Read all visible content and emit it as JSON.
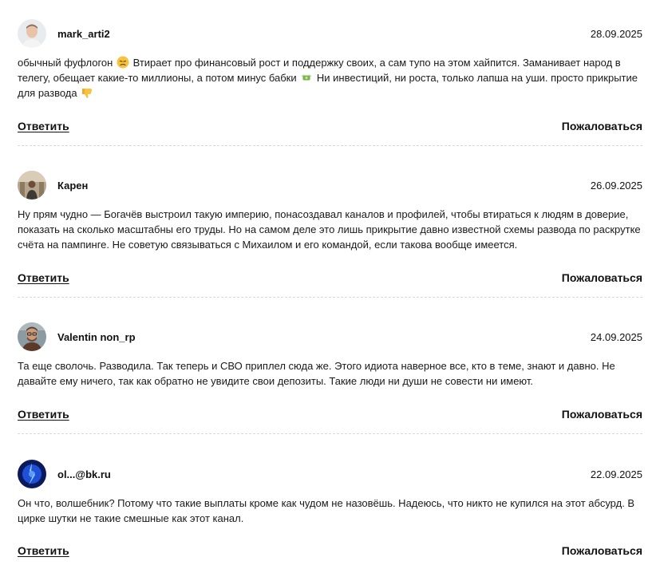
{
  "comments": [
    {
      "author": "mark_arti2",
      "date": "28.09.2025",
      "text_parts": [
        "обычный фуфлогон",
        "Втирает про финансовый рост и поддержку своих, а сам тупо на этом хайпится. Заманивает народ в телегу, обещает какие-то миллионы, а потом минус бабки",
        "Ни инвестиций, ни роста, только лапша на уши. просто прикрытие для развода"
      ],
      "emojis": [
        "disappointed-face-icon",
        "money-with-wings-icon",
        "thumbs-down-icon"
      ]
    },
    {
      "author": "Карен",
      "date": "26.09.2025",
      "text": "Ну прям чудно — Богачёв выстроил такую империю, понасоздавал каналов и профилей, чтобы втираться к людям в доверие, показать на сколько масштабны его труды. Но на самом деле это лишь прикрытие давно известной схемы развода по раскрутке счёта на пампинге. Не советую связываться с Михаилом и его командой, если такова вообще имеется."
    },
    {
      "author": "Valentin non_rp",
      "date": "24.09.2025",
      "text": "Та еще сволочь. Разводила. Так теперь и СВО приплел сюда же. Этого идиота наверное все, кто в теме, знают и давно. Не давайте ему ничего, так как обратно не увидите свои депозиты. Такие люди ни души не совести ни имеют."
    },
    {
      "author": "ol...@bk.ru",
      "date": "22.09.2025",
      "text": "Он что, волшебник? Потому что такие выплаты кроме как чудом не назовёшь. Надеюсь, что никто не купился на этот абсурд. В цирке шутки не такие смешные как этот канал."
    }
  ],
  "actions": {
    "reply_label": "Ответить",
    "complain_label": "Пожаловаться"
  },
  "colors": {
    "text": "#1a1a1a",
    "divider": "#d9d9d9",
    "background": "#ffffff"
  }
}
